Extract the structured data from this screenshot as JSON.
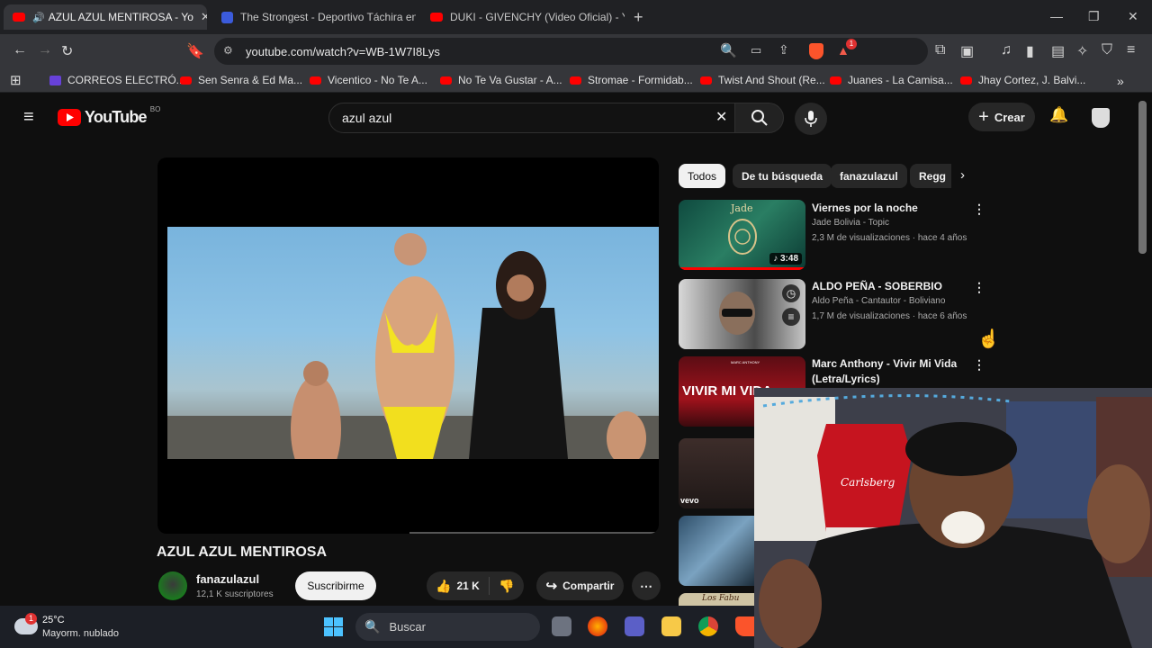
{
  "browser": {
    "tabs": [
      {
        "title": "AZUL AZUL MENTIROSA - Yo",
        "active": true
      },
      {
        "title": "The Strongest - Deportivo Táchira en",
        "active": false
      },
      {
        "title": "DUKI - GIVENCHY (Video Oficial) - Yo",
        "active": false
      }
    ],
    "url": "youtube.com/watch?v=WB-1W7I8Lys",
    "extension_badge": "1",
    "bookmarks": [
      "CORREOS ELECTRÓ...",
      "Sen Senra & Ed Ma...",
      "Vicentico - No Te A...",
      "No Te Va Gustar - A...",
      "Stromae - Formidab...",
      "Twist And Shout (Re...",
      "Juanes - La Camisa...",
      "Jhay Cortez, J. Balvi..."
    ]
  },
  "youtube": {
    "logo_text": "YouTube",
    "country_code": "BO",
    "search_value": "azul azul",
    "create_label": "Crear",
    "chips": [
      "Todos",
      "De tu búsqueda",
      "fanazulazul",
      "Regg"
    ],
    "suggestions": [
      {
        "title": "Viernes por la noche",
        "channel": "Jade Bolivia - Topic",
        "stats": "2,3 M de visualizaciones · hace 4 años",
        "duration": "3:48",
        "thumb_text": "Jade"
      },
      {
        "title": "ALDO PEÑA - SOBERBIO",
        "channel": "Aldo Peña - Cantautor - Boliviano",
        "stats": "1,7 M de visualizaciones · hace 6 años"
      },
      {
        "title": "Marc Anthony - Vivir Mi Vida (Letra/Lyrics)",
        "thumb_text": "VIVIR MI VIDA",
        "thumb_top_text": "MARC ANTHONY"
      },
      {
        "thumb_text": "vevo"
      },
      {},
      {
        "thumb_text": "Los Fabu"
      }
    ],
    "video": {
      "title": "AZUL AZUL MENTIROSA",
      "channel": "fanazulazul",
      "subscribers": "12,1 K suscriptores",
      "subscribe_label": "Suscribirme",
      "likes": "21 K",
      "share_label": "Compartir"
    }
  },
  "webcam": {
    "jersey_text": "Carlsberg"
  },
  "taskbar": {
    "weather_temp": "25°C",
    "weather_desc": "Mayorm. nublado",
    "weather_badge": "1",
    "search_label": "Buscar"
  }
}
